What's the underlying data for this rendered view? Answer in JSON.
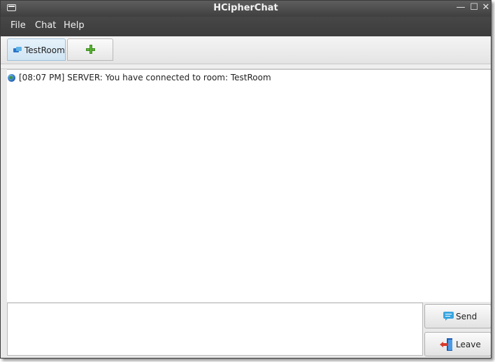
{
  "window": {
    "title": "HCipherChat",
    "controls": {
      "minimize": "—",
      "maximize": "☐",
      "close": "✕"
    }
  },
  "menu": {
    "items": [
      {
        "label": "File"
      },
      {
        "label": "Chat"
      },
      {
        "label": "Help"
      }
    ]
  },
  "tabs": {
    "items": [
      {
        "label": "TestRoom",
        "icon": "chat-rooms-icon",
        "active": true
      }
    ],
    "add_tab_icon": "plus-icon"
  },
  "chat": {
    "messages": [
      {
        "icon": "globe-icon",
        "text": "[08:07 PM] SERVER: You have connected to room: TestRoom"
      }
    ]
  },
  "composer": {
    "input_value": "",
    "send_label": "Send",
    "leave_label": "Leave"
  },
  "colors": {
    "titlebar": "#474747",
    "active_tab": "#cfe4f3",
    "send_icon": "#3aa6e0",
    "leave_arrow": "#d83a2a"
  }
}
